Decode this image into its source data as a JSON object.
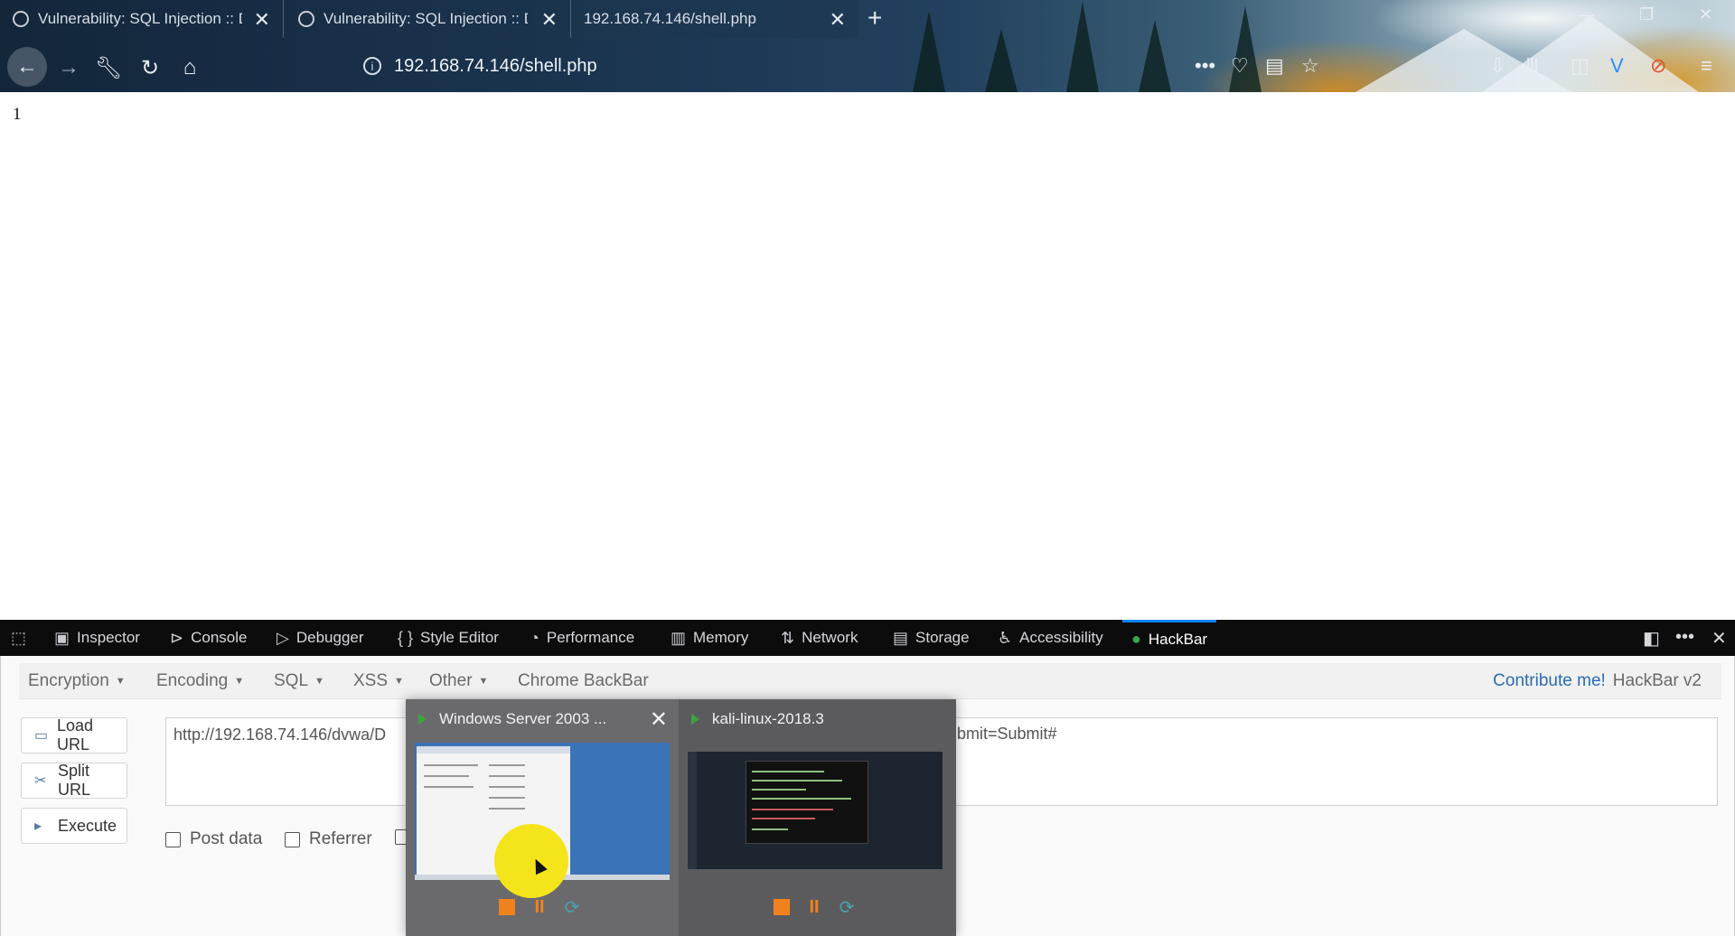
{
  "browser": {
    "tabs": [
      {
        "label": "Vulnerability: SQL Injection :: Damn Vulnerable Web Application"
      },
      {
        "label": "Vulnerability: SQL Injection :: Damn Vulnerable Web Application"
      },
      {
        "label": "192.168.74.146/shell.php",
        "active": true
      }
    ],
    "new_tab_glyph": "+",
    "url": "192.168.74.146/shell.php",
    "window_controls": {
      "minimize": "—",
      "maximize": "❐",
      "close": "✕"
    }
  },
  "page": {
    "output": "1"
  },
  "devtools": {
    "tabs": [
      {
        "label": "Inspector",
        "icon": "inspector-icon"
      },
      {
        "label": "Console",
        "icon": "console-icon"
      },
      {
        "label": "Debugger",
        "icon": "debugger-icon"
      },
      {
        "label": "Style Editor",
        "icon": "style-editor-icon"
      },
      {
        "label": "Performance",
        "icon": "performance-icon"
      },
      {
        "label": "Memory",
        "icon": "memory-icon"
      },
      {
        "label": "Network",
        "icon": "network-icon"
      },
      {
        "label": "Storage",
        "icon": "storage-icon"
      },
      {
        "label": "Accessibility",
        "icon": "accessibility-icon"
      },
      {
        "label": "HackBar",
        "icon": "hackbar-icon",
        "active": true
      }
    ],
    "active_accent": "#0a84ff"
  },
  "hackbar": {
    "menu": [
      "Encryption",
      "Encoding",
      "SQL",
      "XSS",
      "Other"
    ],
    "chrome_backbar": "Chrome BackBar",
    "contribute": "Contribute me!",
    "version": "HackBar v2",
    "buttons": {
      "load_url": "Load URL",
      "split_url": "Split URL",
      "execute": "Execute"
    },
    "url_visible_left": "http://192.168.74.146/dvwa/D",
    "url_visible_right": "bmit=Submit#",
    "checkboxes": {
      "post_data": "Post data",
      "referrer": "Referrer"
    }
  },
  "taskbar_preview": {
    "windows": [
      {
        "title": "Windows Server 2003 ...",
        "close": "✕"
      },
      {
        "title": "kali-linux-2018.3"
      }
    ],
    "controls": {
      "pause": "II",
      "reset": "⟳"
    },
    "accent": "#f0821e"
  }
}
